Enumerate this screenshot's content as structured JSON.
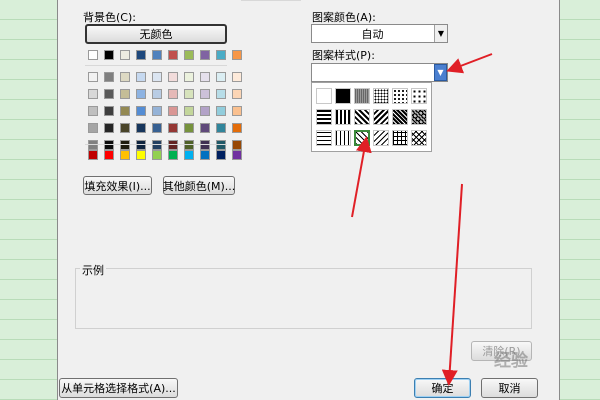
{
  "dialog": {
    "background_label": "背景色(C):",
    "no_color_label": "无颜色",
    "pattern_color_label": "图案颜色(A):",
    "pattern_color_value": "自动",
    "pattern_style_label": "图案样式(P):",
    "fill_effects_label": "填充效果(I)...",
    "more_colors_label": "其他颜色(M)...",
    "sample_label": "示例",
    "clear_label": "清除(R)",
    "from_cell_label": "从单元格选择格式(A)...",
    "ok_label": "确定",
    "cancel_label": "取消",
    "watermark_text": "经验"
  },
  "palette": {
    "row1": [
      "#ffffff",
      "#000000",
      "#eeece1",
      "#1f497d",
      "#4f81bd",
      "#c0504d",
      "#9bbb59",
      "#8064a2",
      "#4bacc6",
      "#f79646"
    ],
    "rows": [
      [
        "#f2f2f2",
        "#7f7f7f",
        "#ddd9c3",
        "#c6d9f0",
        "#dbe5f1",
        "#f2dcdb",
        "#ebf1dd",
        "#e5e0ec",
        "#dbeef3",
        "#fdeada"
      ],
      [
        "#d8d8d8",
        "#595959",
        "#c4bd97",
        "#8db3e2",
        "#b8cce4",
        "#e5b9b7",
        "#d7e3bc",
        "#ccc1d9",
        "#b7dde8",
        "#fbd5b5"
      ],
      [
        "#bfbfbf",
        "#3f3f3f",
        "#938953",
        "#548dd4",
        "#95b3d7",
        "#d99694",
        "#c3d69b",
        "#b2a2c7",
        "#92cddc",
        "#fac08f"
      ],
      [
        "#a5a5a5",
        "#262626",
        "#494429",
        "#17365d",
        "#366092",
        "#953734",
        "#76923c",
        "#5f497a",
        "#31859b",
        "#e36c09"
      ],
      [
        "#7f7f7f",
        "#0c0c0c",
        "#1d1b10",
        "#0f243e",
        "#244061",
        "#632423",
        "#4f6128",
        "#3f3151",
        "#205867",
        "#974806"
      ]
    ],
    "standard": [
      "#c00000",
      "#ff0000",
      "#ffc000",
      "#ffff00",
      "#92d050",
      "#00b050",
      "#00b0f0",
      "#0070c0",
      "#002060",
      "#7030a0"
    ]
  }
}
